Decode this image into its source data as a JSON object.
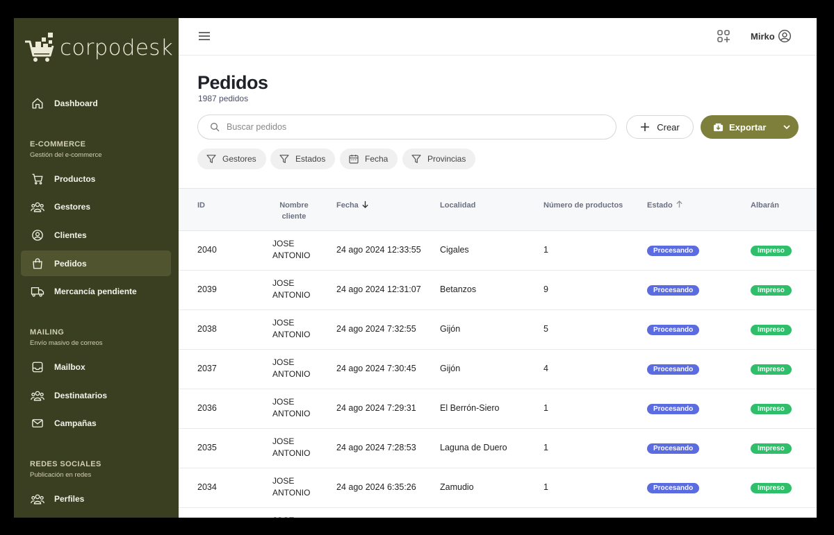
{
  "brand": {
    "name": "corpodesk",
    "icon": "cart-logo-icon"
  },
  "sidebar": {
    "top_items": [
      {
        "label": "Dashboard",
        "icon": "home-icon"
      }
    ],
    "sections": [
      {
        "title": "E-COMMERCE",
        "subtitle": "Gestión del e-commerce",
        "items": [
          {
            "label": "Productos",
            "icon": "cart-icon"
          },
          {
            "label": "Gestores",
            "icon": "users-icon"
          },
          {
            "label": "Clientes",
            "icon": "user-circle-icon"
          },
          {
            "label": "Pedidos",
            "icon": "shopping-bag-icon",
            "active": true
          },
          {
            "label": "Mercancía pendiente",
            "icon": "truck-icon"
          }
        ]
      },
      {
        "title": "MAILING",
        "subtitle": "Envío masivo de correos",
        "items": [
          {
            "label": "Mailbox",
            "icon": "inbox-icon"
          },
          {
            "label": "Destinatarios",
            "icon": "users-icon"
          },
          {
            "label": "Campañas",
            "icon": "mail-icon"
          }
        ]
      },
      {
        "title": "REDES SOCIALES",
        "subtitle": "Publicación en redes",
        "items": [
          {
            "label": "Perfiles",
            "icon": "users-icon"
          }
        ]
      }
    ]
  },
  "topbar": {
    "user_name": "Mirko"
  },
  "page": {
    "title": "Pedidos",
    "subtitle": "1987 pedidos"
  },
  "search": {
    "placeholder": "Buscar pedidos"
  },
  "actions": {
    "create_label": "Crear",
    "export_label": "Exportar"
  },
  "filters": [
    {
      "label": "Gestores",
      "icon": "filter-icon"
    },
    {
      "label": "Estados",
      "icon": "filter-icon"
    },
    {
      "label": "Fecha",
      "icon": "calendar-icon"
    },
    {
      "label": "Provincias",
      "icon": "filter-icon"
    }
  ],
  "table": {
    "columns": [
      "ID",
      "Nombre cliente",
      "Fecha",
      "Localidad",
      "Número de productos",
      "Estado",
      "Albarán"
    ],
    "sort": {
      "Fecha": "desc",
      "Estado": "asc"
    },
    "rows": [
      {
        "id": "2040",
        "name_l1": "JOSE",
        "name_l2": "ANTONIO",
        "date": "24 ago 2024 12:33:55",
        "city": "Cigales",
        "products": "1",
        "status": "Procesando",
        "albaran": "Impreso"
      },
      {
        "id": "2039",
        "name_l1": "JOSE",
        "name_l2": "ANTONIO",
        "date": "24 ago 2024 12:31:07",
        "city": "Betanzos",
        "products": "9",
        "status": "Procesando",
        "albaran": "Impreso"
      },
      {
        "id": "2038",
        "name_l1": "JOSE",
        "name_l2": "ANTONIO",
        "date": "24 ago 2024 7:32:55",
        "city": "Gijón",
        "products": "5",
        "status": "Procesando",
        "albaran": "Impreso"
      },
      {
        "id": "2037",
        "name_l1": "JOSE",
        "name_l2": "ANTONIO",
        "date": "24 ago 2024 7:30:45",
        "city": "Gijón",
        "products": "4",
        "status": "Procesando",
        "albaran": "Impreso"
      },
      {
        "id": "2036",
        "name_l1": "JOSE",
        "name_l2": "ANTONIO",
        "date": "24 ago 2024 7:29:31",
        "city": "El Berrón-Siero",
        "products": "1",
        "status": "Procesando",
        "albaran": "Impreso"
      },
      {
        "id": "2035",
        "name_l1": "JOSE",
        "name_l2": "ANTONIO",
        "date": "24 ago 2024 7:28:53",
        "city": "Laguna de Duero",
        "products": "1",
        "status": "Procesando",
        "albaran": "Impreso"
      },
      {
        "id": "2034",
        "name_l1": "JOSE",
        "name_l2": "ANTONIO",
        "date": "24 ago 2024 6:35:26",
        "city": "Zamudio",
        "products": "1",
        "status": "Procesando",
        "albaran": "Impreso"
      },
      {
        "id": "",
        "name_l1": "JOSE",
        "name_l2": "",
        "date": "",
        "city": "",
        "products": "",
        "status": "",
        "albaran": ""
      }
    ]
  },
  "colors": {
    "sidebar_bg": "#3b3f22",
    "accent": "#7e7f3a",
    "status_blue": "#5b6be0",
    "status_green": "#2fbe6a"
  }
}
